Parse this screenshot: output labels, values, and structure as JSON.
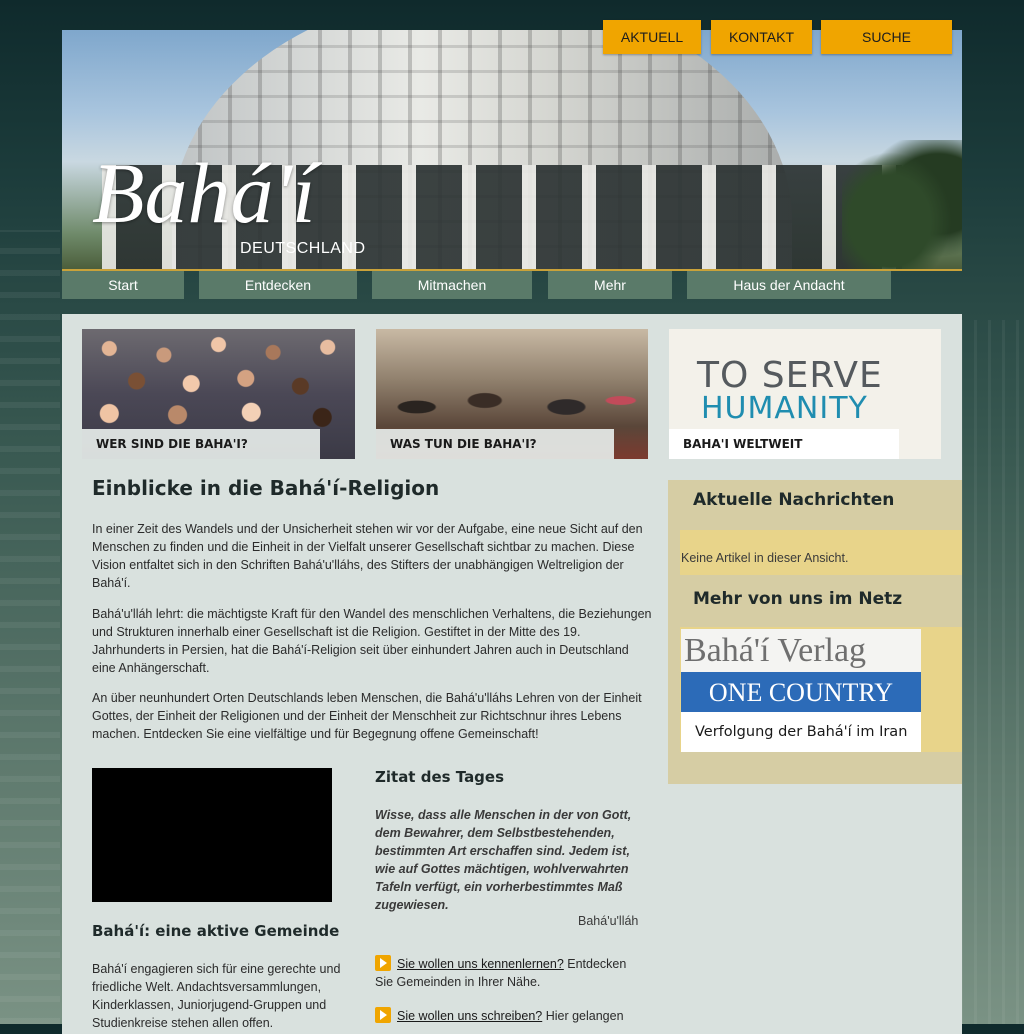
{
  "top_nav": [
    "AKTUELL",
    "KONTAKT",
    "SUCHE"
  ],
  "header": {
    "logo": "Bahá'í",
    "subtitle": "DEUTSCHLAND"
  },
  "main_nav": [
    "Start",
    "Entdecken",
    "Mitmachen",
    "Mehr",
    "Haus der Andacht"
  ],
  "teasers": [
    {
      "caption": "WER SIND DIE BAHA'I?"
    },
    {
      "caption": "WAS TUN DIE BAHA'I?"
    },
    {
      "line1": "TO SERVE",
      "line2": "HUMANITY",
      "caption": "BAHA'I WELTWEIT"
    }
  ],
  "main": {
    "title": "Einblicke in die Bahá'í-Religion",
    "paragraphs": [
      "In einer Zeit des Wandels und der Unsicherheit stehen wir vor der Aufgabe, eine neue Sicht auf den Menschen zu finden und die Einheit in der Vielfalt unserer Gesellschaft sichtbar zu machen. Diese Vision entfaltet sich in den Schriften Bahá'u'lláhs, des Stifters der unabhängigen Weltreligion der Bahá'í.",
      "Bahá'u'lláh lehrt: die mächtigste Kraft für den Wandel des menschlichen Verhaltens, die Beziehungen und Strukturen innerhalb einer Gesellschaft ist die Religion. Gestiftet in der Mitte des 19. Jahrhunderts in Persien, hat die Bahá'í-Religion seit über einhundert Jahren auch in Deutschland eine Anhängerschaft.",
      "An über neunhundert Orten Deutschlands leben Menschen, die Bahá'u'lláhs Lehren von der Einheit Gottes, der Einheit der Religionen und der Einheit der Menschheit zur Richtschnur ihres Lebens machen. Entdecken Sie eine vielfältige und für Begegnung offene Gemeinschaft!"
    ],
    "community_title": "Bahá'í: eine aktive Gemeinde",
    "community_text": "Bahá'í engagieren sich für eine gerechte und friedliche Welt. Andachtsversammlungen, Kinderklassen, Juniorjugend-Gruppen und Studienkreise stehen allen offen.",
    "quote_title": "Zitat des Tages",
    "quote": "Wisse, dass alle Menschen in der von Gott, dem Bewahrer, dem Selbstbestehenden, bestimmten Art erschaffen sind. Jedem ist, wie auf Gottes mächtigen, wohlverwahrten Tafeln verfügt, ein vorherbestimmtes Maß zugewiesen.",
    "quote_author": "Bahá'u'lláh",
    "links": [
      {
        "link": "Sie wollen uns kennenlernen?",
        "text": " Entdecken Sie Gemeinden in Ihrer Nähe."
      },
      {
        "link": "Sie wollen uns schreiben?",
        "text": " Hier gelangen"
      }
    ]
  },
  "sidebar": {
    "news_title": "Aktuelle Nachrichten",
    "no_articles": "Keine Artikel in dieser Ansicht.",
    "more_title": "Mehr von uns im Netz",
    "banners": [
      "Bahá'í Verlag",
      "ONE COUNTRY",
      "Verfolgung der Bahá'í im Iran"
    ]
  },
  "colors": {
    "accent": "#f0a500",
    "nav": "#5a7a69",
    "panel": "#d9e1de",
    "sidebar": "#d6cda4"
  }
}
